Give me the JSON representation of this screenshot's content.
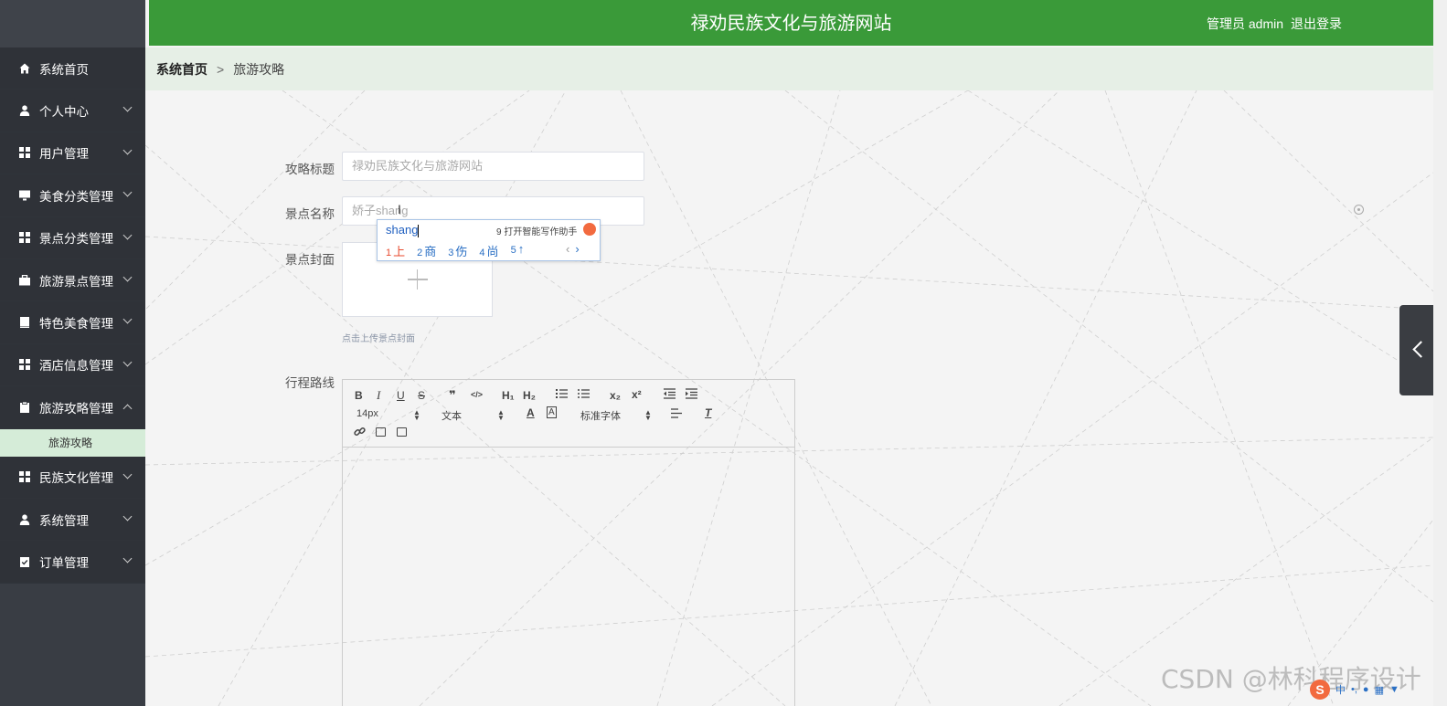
{
  "header": {
    "site_title": "禄劝民族文化与旅游网站",
    "user_label": "管理员 admin",
    "logout_label": "退出登录"
  },
  "sidebar": {
    "items": [
      {
        "label": "系统首页",
        "icon": "home-icon"
      },
      {
        "label": "个人中心",
        "icon": "user-icon"
      },
      {
        "label": "用户管理",
        "icon": "grid-icon"
      },
      {
        "label": "美食分类管理",
        "icon": "monitor-icon"
      },
      {
        "label": "景点分类管理",
        "icon": "grid-icon"
      },
      {
        "label": "旅游景点管理",
        "icon": "briefcase-icon"
      },
      {
        "label": "特色美食管理",
        "icon": "book-icon"
      },
      {
        "label": "酒店信息管理",
        "icon": "grid-icon"
      },
      {
        "label": "旅游攻略管理",
        "icon": "clipboard-icon"
      },
      {
        "label": "民族文化管理",
        "icon": "grid-icon"
      },
      {
        "label": "系统管理",
        "icon": "user-icon"
      },
      {
        "label": "订单管理",
        "icon": "checklist-icon"
      }
    ],
    "active_sub": "旅游攻略"
  },
  "breadcrumb": {
    "home": "系统首页",
    "separator": ">",
    "current": "旅游攻略"
  },
  "form": {
    "title_label": "攻略标题",
    "title_placeholder": "禄劝民族文化与旅游网站",
    "spot_label": "景点名称",
    "spot_value": "娇子shang",
    "cover_label": "景点封面",
    "cover_hint": "点击上传景点封面",
    "route_label": "行程路线"
  },
  "ime": {
    "composition": "shang",
    "assistant": "9 打开智能写作助手",
    "candidates": [
      {
        "n": "1",
        "text": "上"
      },
      {
        "n": "2",
        "text": "商"
      },
      {
        "n": "3",
        "text": "伤"
      },
      {
        "n": "4",
        "text": "尚"
      },
      {
        "n": "5",
        "text": "↑"
      }
    ]
  },
  "editor": {
    "font_size": "14px",
    "text_type": "文本",
    "font_family": "标准字体",
    "h1": "H₁",
    "h2": "H₂",
    "sub": "x₂",
    "sup": "x²",
    "bold": "B",
    "italic": "I",
    "underline": "U",
    "strike": "S",
    "quote": "❞",
    "code": "</>",
    "clear": "T",
    "text_color": "A"
  },
  "watermark": "CSDN @林科程序设计",
  "colors": {
    "header_bg": "#3a9a39",
    "sidebar_bg": "#2f3238",
    "active_sub_bg": "#d5ecd8",
    "breadcrumb_bg": "#e6efe6"
  }
}
